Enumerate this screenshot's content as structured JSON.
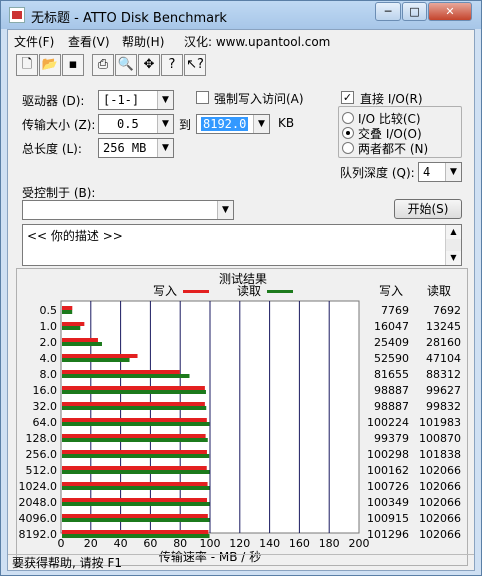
{
  "window": {
    "title": "无标题 - ATTO Disk Benchmark",
    "min_label": "─",
    "max_label": "□",
    "close_label": "✕"
  },
  "menu": {
    "file": "文件(F)",
    "view": "查看(V)",
    "help": "帮助(H)",
    "credit": "汉化: www.upantool.com"
  },
  "toolbar": {
    "icons": [
      "new-icon",
      "open-icon",
      "save-icon",
      "print-icon",
      "print-preview-icon",
      "move-icon",
      "help-icon",
      "context-help-icon"
    ]
  },
  "settings": {
    "drive_label": "驱动器 (D):",
    "drive_value": "[-1-]",
    "transfer_label": "传输大小 (Z):",
    "transfer_from": "0.5",
    "to_label": "到",
    "transfer_to": "8192.0",
    "kb_label": "KB",
    "total_label": "总长度 (L):",
    "total_value": "256 MB",
    "force_write_label": "强制写入访问(A)",
    "direct_io_label": "直接 I/O(R)",
    "io_compare_label": "I/O 比较(C)",
    "overlap_io_label": "交叠 I/O(O)",
    "neither_label": "两者都不 (N)",
    "queue_depth_label": "队列深度 (Q):",
    "queue_depth_value": "4",
    "controlled_by_label": "受控制于 (B):",
    "controlled_by_value": "",
    "start_button": "开始(S)",
    "description": "<<  你的描述  >>"
  },
  "results": {
    "title": "测试结果",
    "legend_write": "写入",
    "legend_read": "读取",
    "col_write": "写入",
    "col_read": "读取",
    "xlabel": "传输速率 - MB / 秒",
    "write_color": "#e32020",
    "read_color": "#1c7a1c"
  },
  "chart_data": {
    "type": "bar",
    "orientation": "horizontal",
    "categories": [
      "0.5",
      "1.0",
      "2.0",
      "4.0",
      "8.0",
      "16.0",
      "32.0",
      "64.0",
      "128.0",
      "256.0",
      "512.0",
      "1024.0",
      "2048.0",
      "4096.0",
      "8192.0"
    ],
    "series": [
      {
        "name": "写入",
        "values": [
          7769,
          16047,
          25409,
          52590,
          81655,
          98887,
          98887,
          100224,
          99379,
          100298,
          100162,
          100726,
          100349,
          100915,
          101296
        ]
      },
      {
        "name": "读取",
        "values": [
          7692,
          13245,
          28160,
          47104,
          88312,
          99627,
          99832,
          101983,
          100870,
          101838,
          102066,
          102066,
          102066,
          102066,
          102066
        ]
      }
    ],
    "xlabel": "传输速率 - MB / 秒",
    "xlim": [
      0,
      200
    ],
    "xticks": [
      "0",
      "20",
      "40",
      "60",
      "80",
      "100",
      "120",
      "140",
      "160",
      "180",
      "200"
    ]
  },
  "status": {
    "text": "要获得帮助, 请按 F1"
  }
}
